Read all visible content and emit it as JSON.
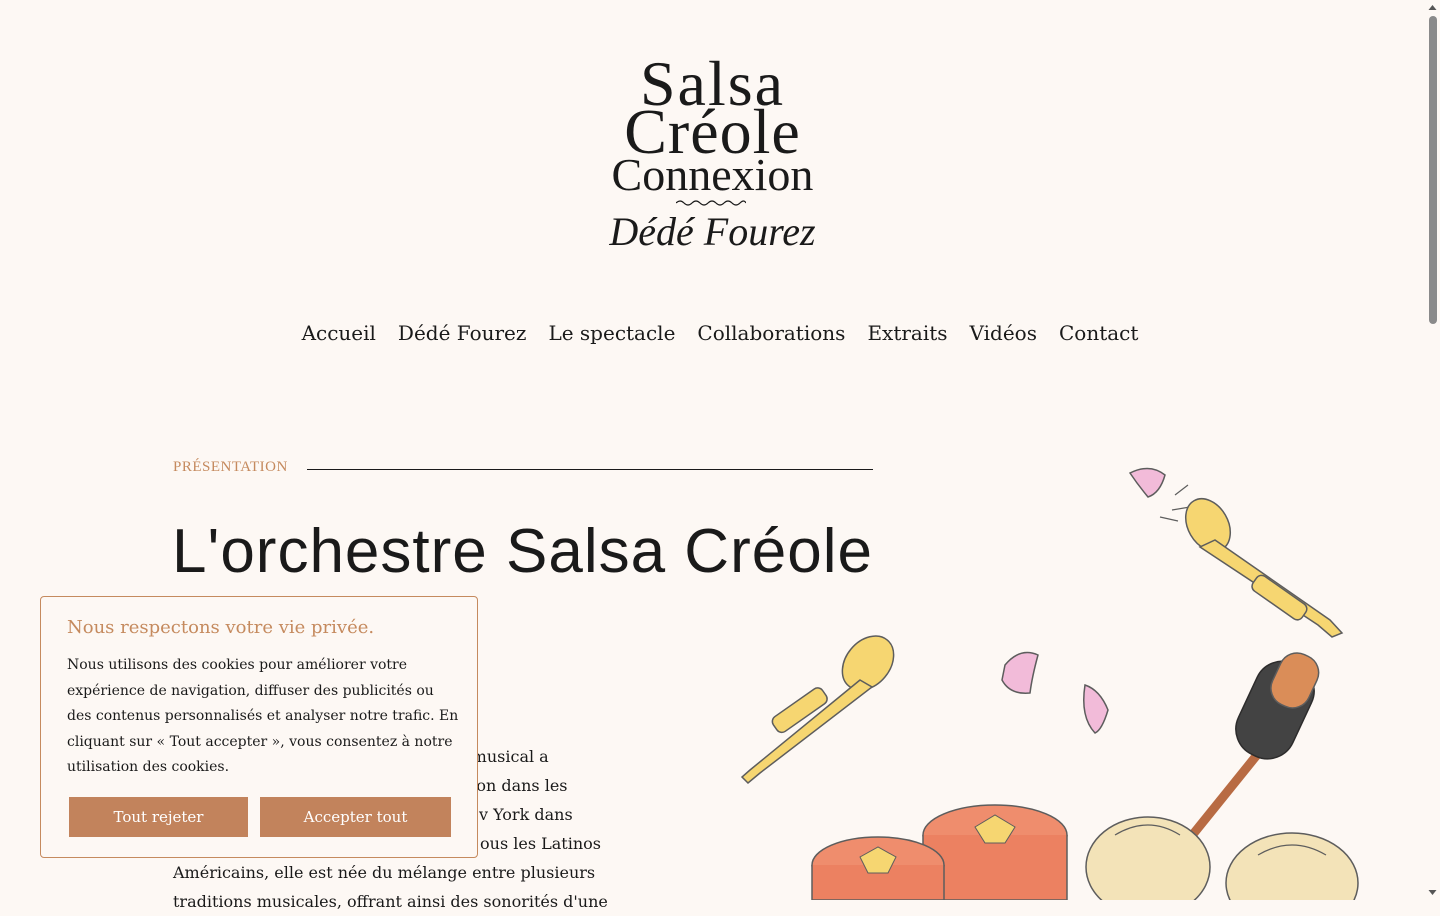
{
  "logo": {
    "line1": "Salsa",
    "line2": "Créole",
    "line3": "Connexion",
    "line4": "Dédé Fourez"
  },
  "nav": {
    "items": [
      "Accueil",
      "Dédé Fourez",
      "Le spectacle",
      "Collaborations",
      "Extraits",
      "Vidéos",
      "Contact"
    ]
  },
  "section": {
    "label": "PRÉSENTATION",
    "title": "L'orchestre Salsa Créole",
    "body": "Le style musical a fait son apparition dans les quartiers de New York dans les années 60. Comme tous les Latinos Américains, elle est née du mélange entre plusieurs traditions musicales, offrant ainsi des sonorités d'une"
  },
  "body_visible": {
    "lines": [
      "le musical a",
      "rition dans les",
      "v York dans",
      "ous les Latinos",
      "Américains, elle est née du mélange entre plusieurs",
      "traditions musicales, offrant ainsi des sonorités d'une"
    ]
  },
  "cookie": {
    "title": "Nous respectons votre vie privée.",
    "text": "Nous utilisons des cookies pour améliorer votre expérience de navigation, diffuser des publicités ou des contenus personnalisés et analyser notre trafic. En cliquant sur « Tout accepter », vous consentez à notre utilisation des cookies.",
    "reject_label": "Tout rejeter",
    "accept_label": "Accepter tout"
  },
  "colors": {
    "background": "#fdf8f4",
    "accent": "#c58a5e",
    "button": "#c2835c",
    "text": "#1a1a1a"
  },
  "icons": [
    "trumpet-illustration",
    "microphone-illustration",
    "tomato-illustration",
    "onion-illustration",
    "garlic-illustration"
  ]
}
